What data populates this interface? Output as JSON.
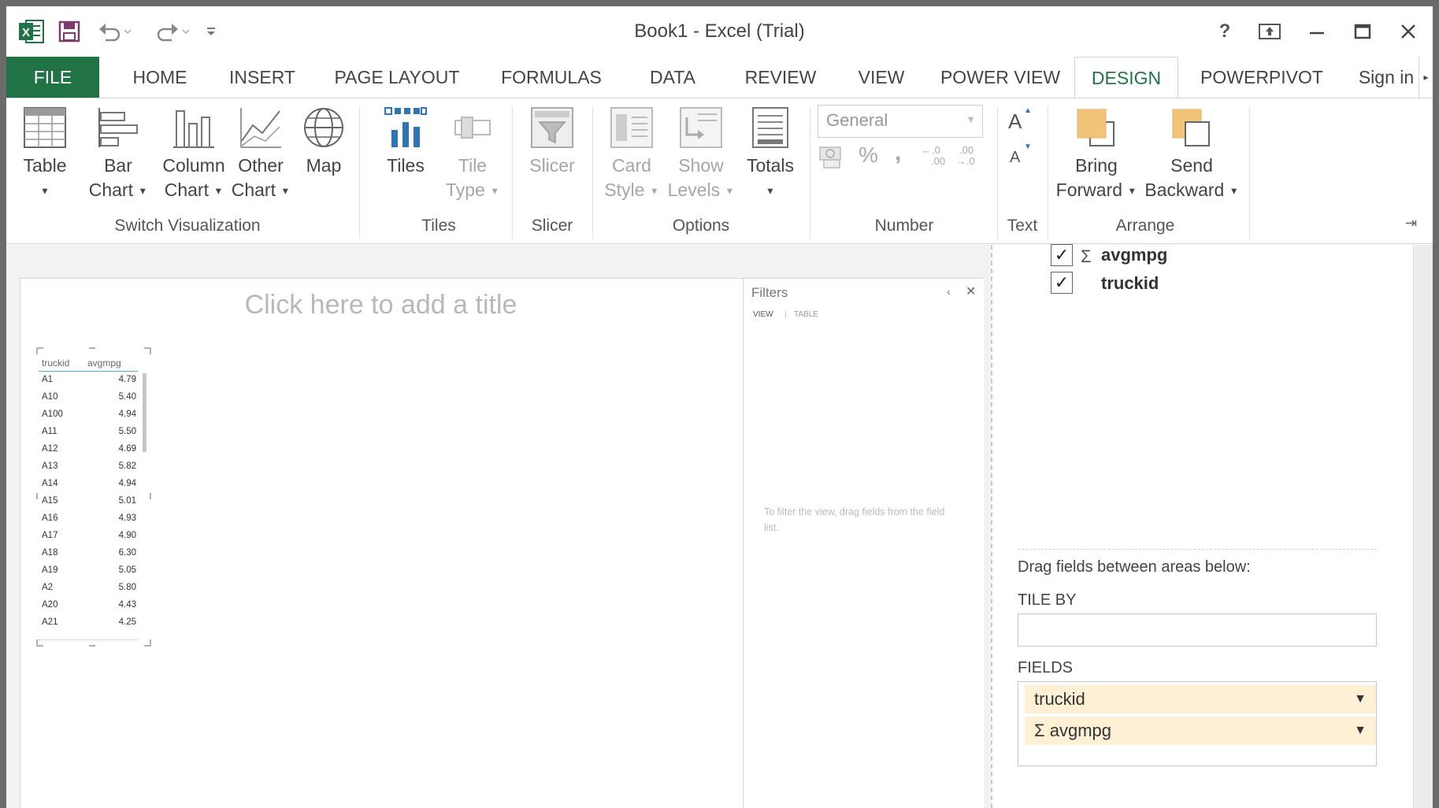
{
  "window": {
    "title": "Book1 - Excel (Trial)"
  },
  "tabs": [
    {
      "label": "FILE"
    },
    {
      "label": "HOME"
    },
    {
      "label": "INSERT"
    },
    {
      "label": "PAGE LAYOUT"
    },
    {
      "label": "FORMULAS"
    },
    {
      "label": "DATA"
    },
    {
      "label": "REVIEW"
    },
    {
      "label": "VIEW"
    },
    {
      "label": "POWER VIEW"
    },
    {
      "label": "DESIGN"
    },
    {
      "label": "POWERPIVOT"
    }
  ],
  "sign_in": "Sign in",
  "ribbon": {
    "switch_viz": {
      "group": "Switch Visualization",
      "table": "Table",
      "bar": [
        "Bar",
        "Chart"
      ],
      "column": [
        "Column",
        "Chart"
      ],
      "other": [
        "Other",
        "Chart"
      ],
      "map": "Map"
    },
    "tiles": {
      "group": "Tiles",
      "tiles": "Tiles",
      "tile_type": [
        "Tile",
        "Type"
      ]
    },
    "slicer": {
      "group": "Slicer",
      "slicer": "Slicer"
    },
    "options": {
      "group": "Options",
      "card_style": [
        "Card",
        "Style"
      ],
      "show_levels": [
        "Show",
        "Levels"
      ],
      "totals": "Totals"
    },
    "number": {
      "group": "Number",
      "format_value": "General",
      "percent": "%",
      "comma": ",",
      "inc_decimal": ".00",
      "dec_decimal": ".00"
    },
    "text": {
      "group": "Text",
      "font_grow": "A",
      "font_shrink": "A"
    },
    "arrange": {
      "group": "Arrange",
      "bring_forward": [
        "Bring",
        "Forward"
      ],
      "send_backward": [
        "Send",
        "Backward"
      ]
    }
  },
  "canvas": {
    "title_placeholder": "Click here to add a title",
    "table": {
      "headers": [
        "truckid",
        "avgmpg"
      ],
      "rows": [
        [
          "A1",
          "4.79"
        ],
        [
          "A10",
          "5.40"
        ],
        [
          "A100",
          "4.94"
        ],
        [
          "A11",
          "5.50"
        ],
        [
          "A12",
          "4.69"
        ],
        [
          "A13",
          "5.82"
        ],
        [
          "A14",
          "4.94"
        ],
        [
          "A15",
          "5.01"
        ],
        [
          "A16",
          "4.93"
        ],
        [
          "A17",
          "4.90"
        ],
        [
          "A18",
          "6.30"
        ],
        [
          "A19",
          "5.05"
        ],
        [
          "A2",
          "5.80"
        ],
        [
          "A20",
          "4.43"
        ],
        [
          "A21",
          "4.25"
        ]
      ]
    }
  },
  "filters": {
    "title": "Filters",
    "tab_view": "VIEW",
    "tab_table": "TABLE",
    "hint": "To filter the view, drag fields from the field list."
  },
  "field_list": {
    "fields": [
      {
        "name": "avgmpg",
        "sigma": "Σ"
      },
      {
        "name": "truckid",
        "sigma": ""
      }
    ],
    "drag_hint": "Drag fields between areas below:",
    "tile_by_label": "TILE BY",
    "fields_label": "FIELDS",
    "fields_area": [
      {
        "name": "truckid",
        "sigma": ""
      },
      {
        "name": "avgmpg",
        "sigma": "Σ"
      }
    ]
  }
}
